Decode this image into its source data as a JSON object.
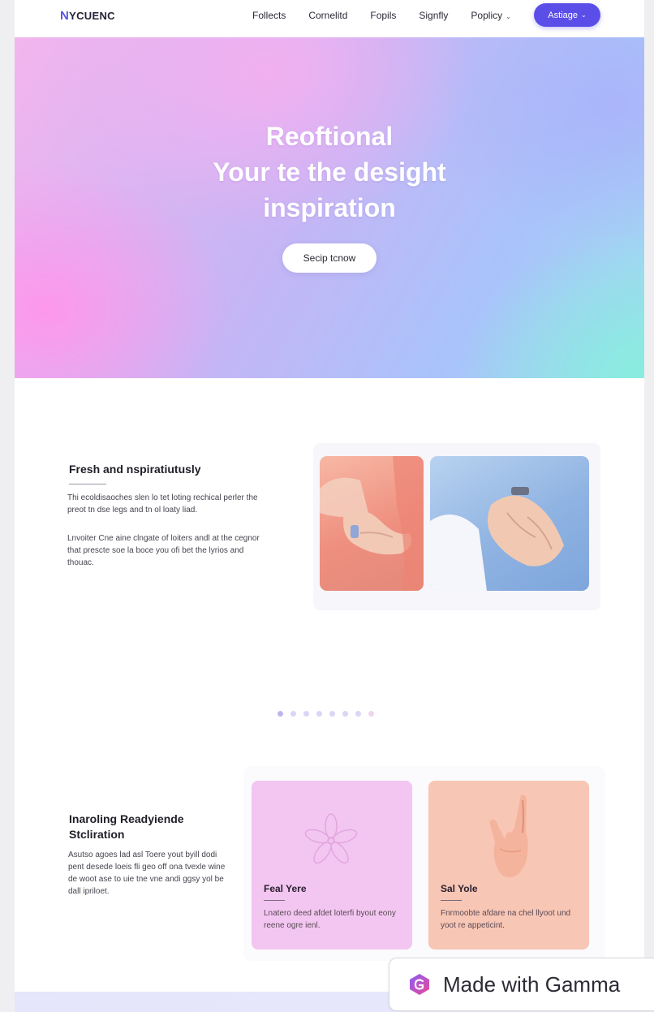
{
  "nav": {
    "logo": "YCUENC",
    "logo_mark": "N",
    "links": [
      {
        "label": "Follects",
        "has_chevron": false
      },
      {
        "label": "Cornelitd",
        "has_chevron": false
      },
      {
        "label": "Fopils",
        "has_chevron": false
      },
      {
        "label": "Signfly",
        "has_chevron": false
      },
      {
        "label": "Poplicy",
        "has_chevron": true
      }
    ],
    "cta_label": "Astiage",
    "chevron": "⌄"
  },
  "hero": {
    "title_lines": [
      "Reoftional",
      "Your te the desight",
      "inspiration"
    ],
    "button_label": "Secip tcnow"
  },
  "section1": {
    "title": "Fresh and nspiratiutusly",
    "paragraph1": "Thi ecoldisaoches slen lo tet loting rechical perler the preot tn dse legs and tn ol loaty liad.",
    "paragraph2": "Lnvoiter Cne aine clngate of loiters andl at the cegnor that prescte soe la boce you ofi bet the lyrios and thouac.",
    "images": [
      {
        "name": "hands-pink-photo"
      },
      {
        "name": "hands-blue-photo"
      }
    ]
  },
  "carousel": {
    "dot_count": 8,
    "active_index": 0
  },
  "section2": {
    "title": "Inaroling Readyiende Stcliration",
    "paragraph": "Asutso agoes lad asl Toere yout byill dodi pent desede loeis fli geo off ona tvexle wine de woot ase to uie tne vne andi ggsy yol be dall ipriloet.",
    "cards": [
      {
        "title": "Feal Yere",
        "text": "Lnatero deed afdet loterfi byout eony reene ogre ienl.",
        "icon": "flower-icon",
        "color": "#f3c6f1"
      },
      {
        "title": "Sal Yole",
        "text": "Fnrmoobte afdare na chel llyoot und yoot re appeticint.",
        "icon": "hand-gesture-icon",
        "color": "#f8c6b4"
      }
    ]
  },
  "badge": {
    "label": "Made with Gamma",
    "icon": "gamma-logo-icon"
  },
  "colors": {
    "accent": "#5b4ee8",
    "card_pink": "#f3c6f1",
    "card_peach": "#f8c6b4"
  }
}
